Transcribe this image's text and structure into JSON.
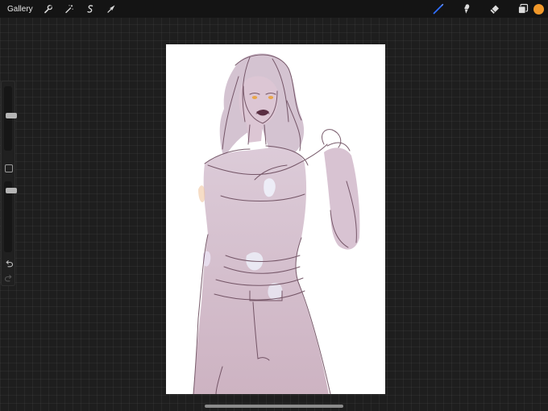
{
  "toolbar": {
    "gallery_label": "Gallery",
    "left_tools": [
      "wrench-icon",
      "magic-wand-icon",
      "selection-icon",
      "transform-icon"
    ],
    "right_tools": [
      "brush-icon",
      "smudge-icon",
      "eraser-icon",
      "layers-icon"
    ],
    "active_tool": "brush",
    "accent_color": "#2f6fff",
    "current_color": "#f0982a"
  },
  "sidebar": {
    "brush_size_level": 0.55,
    "opacity_level": 0.9,
    "icons": [
      "modify-square-icon",
      "undo-icon",
      "redo-icon"
    ]
  },
  "canvas": {
    "background": "#ffffff",
    "artwork": "figure-sketch"
  }
}
